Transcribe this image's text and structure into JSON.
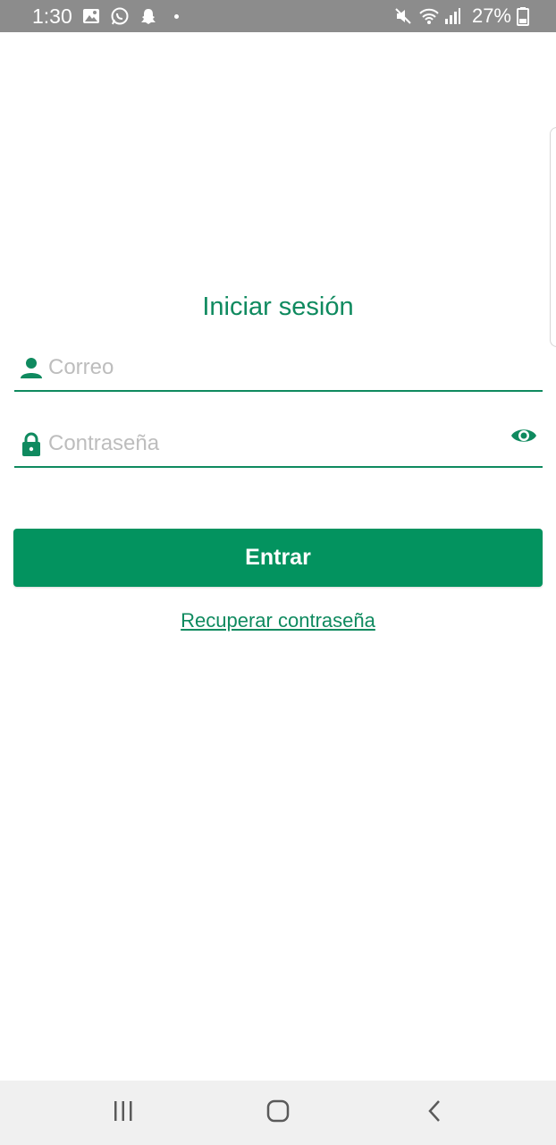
{
  "status_bar": {
    "time": "1:30",
    "battery_percent": "27%",
    "icons": [
      "gallery-icon",
      "whatsapp-icon",
      "snapchat-icon",
      "dot-icon",
      "mute-icon",
      "wifi-icon",
      "signal-icon",
      "battery-icon"
    ]
  },
  "login": {
    "title": "Iniciar sesión",
    "email_placeholder": "Correo",
    "password_placeholder": "Contraseña",
    "submit_label": "Entrar",
    "recover_label": "Recuperar contraseña"
  },
  "colors": {
    "accent": "#0f8a5f",
    "button": "#03935f",
    "statusbar": "#8c8c8c",
    "navbar": "#f0f0f0"
  },
  "navigation_bar": {
    "buttons": [
      "recents-icon",
      "home-icon",
      "back-icon"
    ]
  }
}
